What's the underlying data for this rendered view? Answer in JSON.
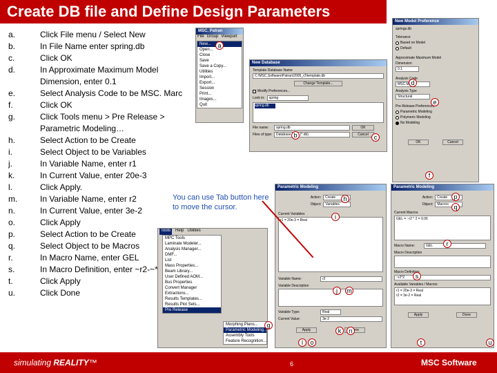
{
  "title": "Create DB file and Define Design Parameters",
  "steps": [
    {
      "label": "a.",
      "text": "Click File menu / Select New"
    },
    {
      "label": "b.",
      "text": "In File Name enter spring.db"
    },
    {
      "label": "c.",
      "text": "Click OK"
    },
    {
      "label": "d.",
      "text": "In Approximate Maximum Model Dimension, enter 0.1"
    },
    {
      "label": "e.",
      "text": "Select Analysis Code to be MSC. Marc"
    },
    {
      "label": "f.",
      "text": "Click OK"
    },
    {
      "label": "g.",
      "text": "Click Tools menu > Pre Release > Parametric Modeling…"
    },
    {
      "label": "h.",
      "text": "Select Action to be Create"
    },
    {
      "label": "i.",
      "text": "Select Object to be Variables"
    },
    {
      "label": "j.",
      "text": "In Variable Name, enter r1"
    },
    {
      "label": "k.",
      "text": "In Current Value, enter 20e-3"
    },
    {
      "label": "l.",
      "text": "Click Apply."
    },
    {
      "label": "m.",
      "text": "In Variable Name, enter r2"
    },
    {
      "label": "n.",
      "text": "In Current Value, enter 3e-2"
    },
    {
      "label": "o.",
      "text": "Click Apply"
    },
    {
      "label": "p.",
      "text": "Select Action to be Create"
    },
    {
      "label": "q.",
      "text": "Select Object to be Macros"
    },
    {
      "label": "r.",
      "text": "In Macro Name, enter GEL"
    },
    {
      "label": "s.",
      "text": "In Macro Definition, enter ~r2-~*2"
    },
    {
      "label": "t.",
      "text": "Click Apply"
    },
    {
      "label": "u.",
      "text": "Click Done"
    }
  ],
  "note": "You can use Tab button here to move the cursor.",
  "file_menu": {
    "title": "MSC. Patran",
    "menubar": [
      "File",
      "Group",
      "Viewport"
    ],
    "items": [
      "New...",
      "Open...",
      "Close",
      "Save",
      "Save a Copy...",
      "Utilities",
      "Import...",
      "Export...",
      "Session",
      "Print...",
      "Images...",
      "Quit"
    ],
    "shortcuts": [
      "Ctrl+N",
      "Ctrl+O",
      "",
      "Ctrl+S"
    ]
  },
  "new_db": {
    "title": "New Database",
    "template_label": "Template Database Name",
    "template_value": "C:\\MSC.Software\\Patran\\2005_r2\\template.db",
    "change_template": "Change Template...",
    "modify_pref": "Modify Preferences...",
    "look_in_label": "Look in:",
    "look_in_value": "spring",
    "file_item": "spring.db",
    "file_name_label": "File name:",
    "file_name_value": "spring.db",
    "files_type_label": "Files of type:",
    "files_type_value": "Database Files (*.db)",
    "ok": "OK",
    "cancel": "Cancel"
  },
  "new_model_pref": {
    "title": "New Model Preference",
    "heading": "springs.db",
    "tolerance_label": "Tolerance",
    "tol_default": "Based on Model",
    "tol_default2": "Default",
    "approx_label": "Approximate Maximum Model Dimension",
    "approx_value": "0.1",
    "analysis_code_label": "Analysis Code",
    "analysis_code_value": "MSC.Marc",
    "analysis_type_label": "Analysis Type",
    "analysis_type_value": "Structural",
    "pref_label": "Pre-Release Preferences",
    "pref_items": [
      "Parametric Modeling",
      "Polymeric Modeling",
      "No Modeling"
    ],
    "ok": "OK",
    "cancel": "Cancel"
  },
  "tools_menu": {
    "menubar": [
      "Tools",
      "Help",
      "Utilities"
    ],
    "items": [
      "MPC Tools",
      "Laminate Modeler...",
      "Analysis Manager...",
      "DMF...",
      "List",
      "Mass Properties...",
      "Beam Library...",
      "User Defined AOM...",
      "Bus Properties",
      "Convert Manager",
      "Extractions...",
      "Results Templates...",
      "Results Plot Sets...",
      "Pre Release"
    ],
    "submenu": [
      "Morphing Plans...",
      "Parametric Modeling...",
      "Assembly Tools",
      "Feature Recognition..."
    ]
  },
  "param_var": {
    "title": "Parametric Modeling",
    "action_label": "Action:",
    "action_value": "Create",
    "object_label": "Object:",
    "object_value": "Variables",
    "list_label": "Current Variables",
    "list_items": [
      "r1 = 20e-3 = Real"
    ],
    "var_name_label": "Variable Name:",
    "var_name_value": "r2",
    "var_desc_label": "Variable Description",
    "var_type_label": "Variable Type:",
    "var_type_value": "Real",
    "cur_value_label": "Current Value:",
    "cur_value_value": "3e-2",
    "apply": "Apply",
    "done": "Done"
  },
  "param_macro": {
    "title": "Parametric Modeling",
    "action_label": "Action:",
    "action_value": "Create",
    "object_label": "Object:",
    "object_value": "Macros",
    "list_label": "Current Macros",
    "list_items": [
      "GEL = ~r2 * 2 = 0.06"
    ],
    "macro_name_label": "Macro Name:",
    "macro_name_value": "GEL",
    "macro_desc_label": "Macro Description",
    "macro_def_label": "Macro Definition:",
    "macro_def_value": "~r2*2",
    "available_label": "Available Variables / Macros",
    "available_items": [
      "r1 = 20e-3 = Real",
      "r2 = 3e-2 = Real"
    ],
    "apply": "Apply",
    "done": "Done"
  },
  "callouts": [
    "a",
    "b",
    "c",
    "d",
    "e",
    "f",
    "g",
    "h",
    "i",
    "j",
    "k",
    "l",
    "m",
    "n",
    "o",
    "p",
    "q",
    "r",
    "s",
    "t",
    "u"
  ],
  "footer": {
    "brand": "simulating",
    "brand_bold": "REALITY",
    "tm": "™",
    "page": "6",
    "logo": "MSC Software"
  }
}
